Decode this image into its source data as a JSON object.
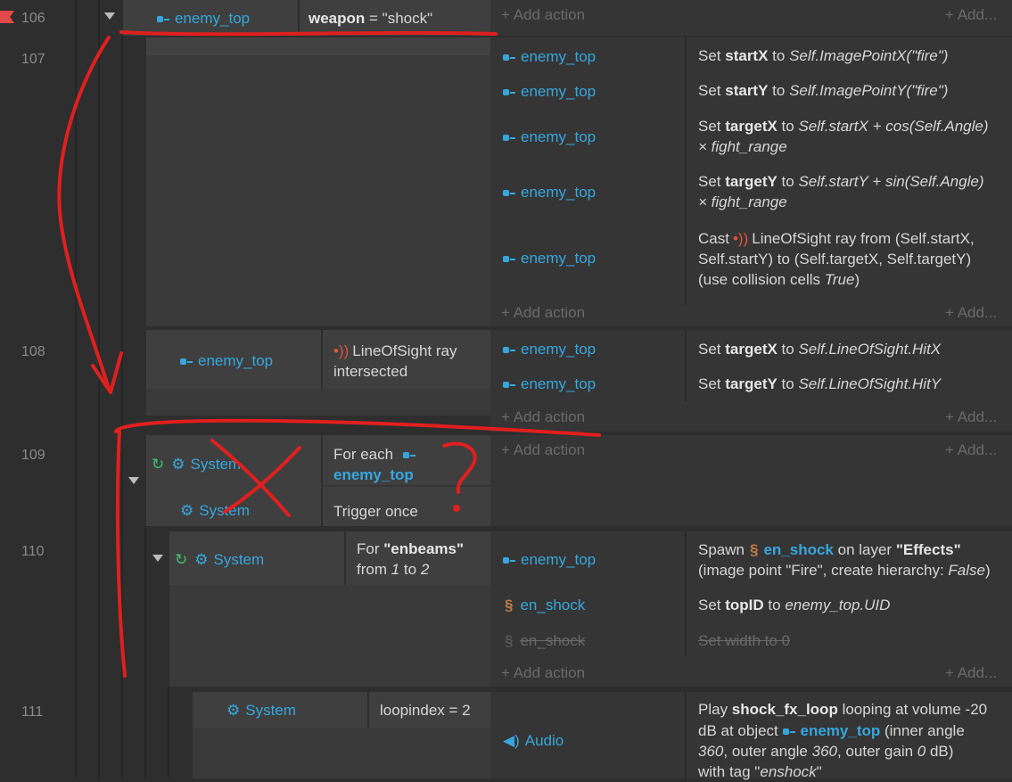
{
  "rows": {
    "r106": {
      "num": "106",
      "cond_object": "enemy_top",
      "cond_text_bold": "weapon",
      "cond_text_rest": " = \"shock\"",
      "add_action": "Add action",
      "add_more": "Add..."
    },
    "r107": {
      "num": "107",
      "actions": [
        {
          "object": "enemy_top",
          "pre": "Set ",
          "bold": "startX",
          "mid": " to ",
          "ital": "Self.ImagePointX(\"fire\")"
        },
        {
          "object": "enemy_top",
          "pre": "Set ",
          "bold": "startY",
          "mid": " to ",
          "ital": "Self.ImagePointY(\"fire\")"
        },
        {
          "object": "enemy_top",
          "pre": "Set ",
          "bold": "targetX",
          "mid": " to ",
          "ital": "Self.startX + cos(Self.Angle)",
          "line2": "× fight_range"
        },
        {
          "object": "enemy_top",
          "pre": "Set ",
          "bold": "targetY",
          "mid": " to ",
          "ital": "Self.startY + sin(Self.Angle)",
          "line2": "× fight_range"
        },
        {
          "object": "enemy_top",
          "cast_pre": "Cast",
          "cast_text": "LineOfSight ray from (Self.startX,",
          "cast_line2": "Self.startY) to (Self.targetX, Self.targetY)",
          "cast_line3_pre": "(use collision cells ",
          "cast_line3_ital": "True",
          "cast_line3_post": ")"
        }
      ],
      "add_action": "Add action",
      "add_more": "Add..."
    },
    "r108": {
      "num": "108",
      "cond_object": "enemy_top",
      "cond_text1": "LineOfSight ray",
      "cond_text2": "intersected",
      "actions": [
        {
          "object": "enemy_top",
          "pre": "Set ",
          "bold": "targetX",
          "mid": " to ",
          "ital": "Self.LineOfSight.HitX"
        },
        {
          "object": "enemy_top",
          "pre": "Set ",
          "bold": "targetY",
          "mid": " to ",
          "ital": "Self.LineOfSight.HitY"
        }
      ],
      "add_action": "Add action",
      "add_more": "Add..."
    },
    "r109": {
      "num": "109",
      "cond1_object": "System",
      "cond1_text": "For each",
      "cond1_target": "enemy_top",
      "cond2_object": "System",
      "cond2_text": "Trigger once",
      "add_action": "Add action",
      "add_more": "Add..."
    },
    "r110": {
      "num": "110",
      "cond_object": "System",
      "cond_pre": "For ",
      "cond_bold": "\"enbeams\"",
      "cond_line2_pre": "from ",
      "cond_line2_a": "1",
      "cond_line2_mid": " to ",
      "cond_line2_b": "2",
      "actions": [
        {
          "object": "enemy_top",
          "spawn_pre": "Spawn",
          "spawn_obj": "en_shock",
          "spawn_mid": " on layer ",
          "spawn_layer": "\"Effects\"",
          "line2_pre": "(image point \"Fire\", create hierarchy: ",
          "line2_ital": "False",
          "line2_post": ")"
        },
        {
          "object": "en_shock",
          "pre": "Set ",
          "bold": "topID",
          "mid": " to ",
          "ital": "enemy_top.UID"
        },
        {
          "object": "en_shock",
          "disabled_text": "Set width to 0"
        }
      ],
      "add_action": "Add action",
      "add_more": "Add..."
    },
    "r111": {
      "num": "111",
      "cond_object": "System",
      "cond_text": "loopindex = 2",
      "action_object": "Audio",
      "play_pre": "Play ",
      "play_bold": "shock_fx_loop",
      "play_mid": " looping at volume -20",
      "play_line2_pre": "dB at object ",
      "play_line2_obj": "enemy_top",
      "play_line2_post": " (inner angle",
      "play_line3_a": "360",
      "play_line3_mid": ", outer angle ",
      "play_line3_b": "360",
      "play_line3_mid2": ", outer gain ",
      "play_line3_c": "0",
      "play_line3_post": " dB)",
      "play_line4_pre": "with tag \"",
      "play_line4_ital": "enshock",
      "play_line4_post": "\""
    }
  },
  "icons": {
    "object": "object-type-icon",
    "system": "gear-icon",
    "loop": "loop-icon",
    "beam": "ray-icon",
    "spawn": "sprite-icon",
    "audio": "speaker-icon"
  },
  "colors": {
    "object": "#36a7dd",
    "annotation": "#e0201e",
    "loop": "#3dc46a"
  }
}
